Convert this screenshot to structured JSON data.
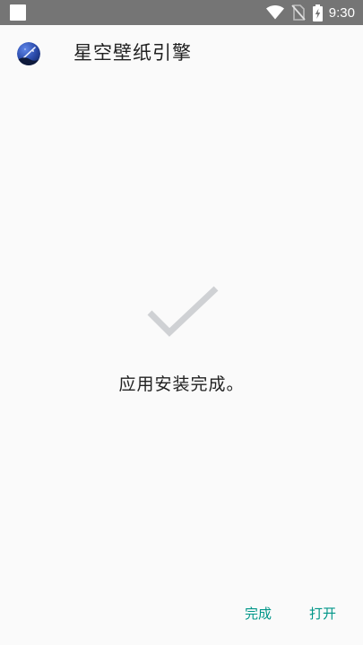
{
  "status_bar": {
    "time": "9:30",
    "icons": [
      "notification-square-icon",
      "wifi-icon",
      "no-sim-icon",
      "battery-charging-icon"
    ]
  },
  "header": {
    "app_icon": "starry-sky-app-icon",
    "title": "星空壁纸引擎"
  },
  "main": {
    "status_icon": "checkmark-icon",
    "message": "应用安装完成。"
  },
  "actions": {
    "done_label": "完成",
    "open_label": "打开"
  },
  "colors": {
    "status_bar": "#757575",
    "background": "#fafafa",
    "accent": "#009688",
    "check": "#cfd1d4",
    "text": "#212121"
  }
}
